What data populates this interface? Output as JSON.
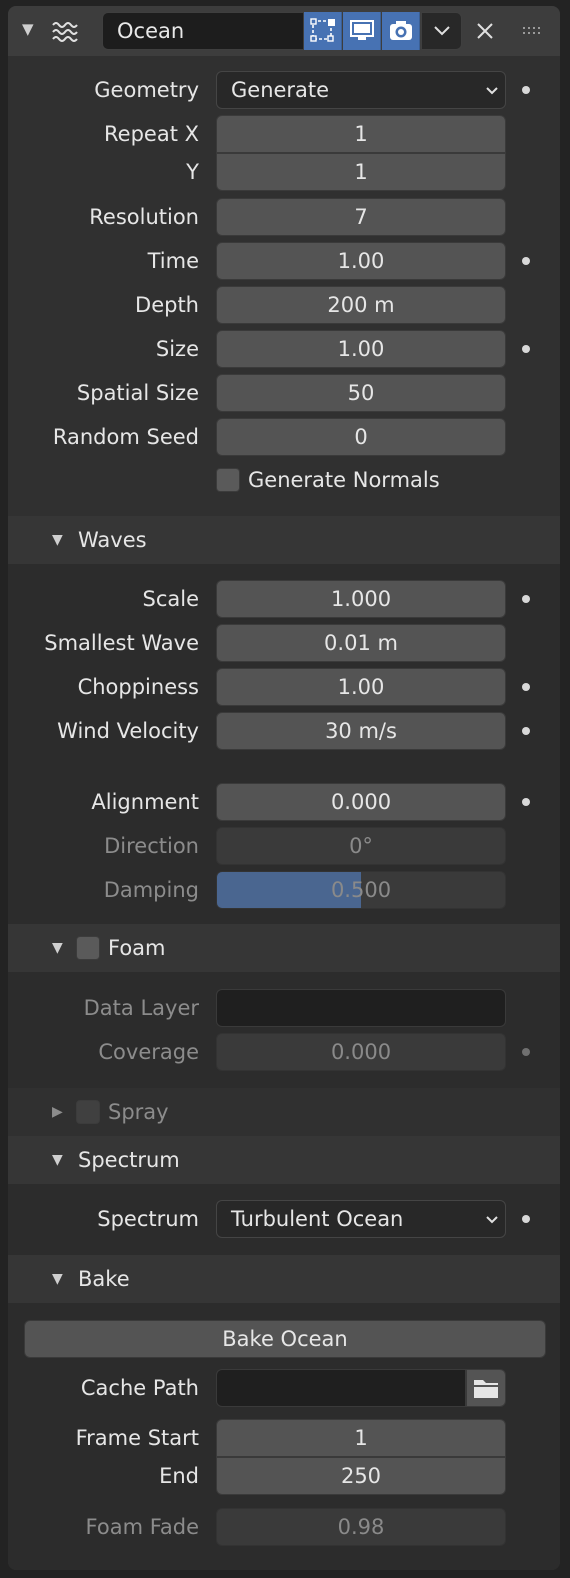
{
  "header": {
    "modifier_name": "Ocean",
    "icons": [
      "ocean-modifier-icon",
      "edit-mode-icon",
      "viewport-icon",
      "render-icon",
      "chevron-down-icon",
      "close-icon",
      "grip-icon"
    ],
    "accent": "#4772b3"
  },
  "main": {
    "geometry": {
      "label": "Geometry",
      "value": "Generate"
    },
    "repeat_x": {
      "label": "Repeat X",
      "value": "1"
    },
    "repeat_y": {
      "label": "Y",
      "value": "1"
    },
    "resolution": {
      "label": "Resolution",
      "value": "7"
    },
    "time": {
      "label": "Time",
      "value": "1.00"
    },
    "depth": {
      "label": "Depth",
      "value": "200 m"
    },
    "size": {
      "label": "Size",
      "value": "1.00"
    },
    "spatial_size": {
      "label": "Spatial Size",
      "value": "50"
    },
    "random_seed": {
      "label": "Random Seed",
      "value": "0"
    },
    "generate_normals": {
      "label": "Generate Normals",
      "checked": false
    }
  },
  "waves": {
    "title": "Waves",
    "scale": {
      "label": "Scale",
      "value": "1.000"
    },
    "smallest_wave": {
      "label": "Smallest Wave",
      "value": "0.01 m"
    },
    "choppiness": {
      "label": "Choppiness",
      "value": "1.00"
    },
    "wind_velocity": {
      "label": "Wind Velocity",
      "value": "30 m/s"
    },
    "alignment": {
      "label": "Alignment",
      "value": "0.000"
    },
    "direction": {
      "label": "Direction",
      "value": "0°"
    },
    "damping": {
      "label": "Damping",
      "value": "0.500",
      "fraction": 0.5
    }
  },
  "foam": {
    "title": "Foam",
    "data_layer": {
      "label": "Data Layer",
      "value": ""
    },
    "coverage": {
      "label": "Coverage",
      "value": "0.000"
    }
  },
  "spray": {
    "title": "Spray"
  },
  "spectrum": {
    "title": "Spectrum",
    "spectrum": {
      "label": "Spectrum",
      "value": "Turbulent Ocean"
    }
  },
  "bake": {
    "title": "Bake",
    "bake_button": "Bake Ocean",
    "cache_path": {
      "label": "Cache Path",
      "value": ""
    },
    "frame_start": {
      "label": "Frame Start",
      "value": "1"
    },
    "frame_end": {
      "label": "End",
      "value": "250"
    },
    "foam_fade": {
      "label": "Foam Fade",
      "value": "0.98"
    }
  }
}
